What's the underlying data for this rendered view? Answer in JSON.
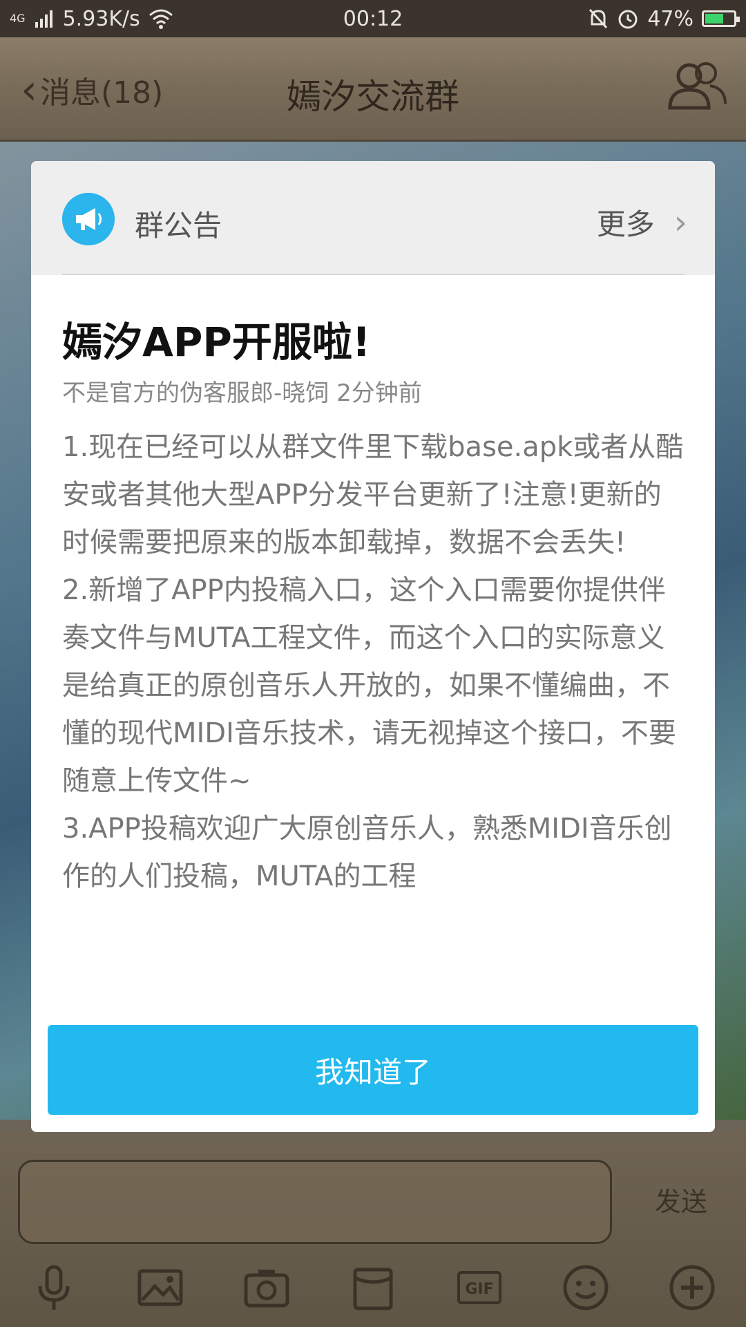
{
  "status_bar": {
    "network": "4G",
    "speed": "5.93K/s",
    "time": "00:12",
    "battery": "47%"
  },
  "header": {
    "back_label": "消息(18)",
    "title": "嫣汐交流群"
  },
  "modal": {
    "header_title": "群公告",
    "more_label": "更多",
    "title": "嫣汐APP开服啦!",
    "meta": "不是官方的伪客服郎-晓饲 2分钟前",
    "body": "1.现在已经可以从群文件里下载base.apk或者从酷安或者其他大型APP分发平台更新了!注意!更新的时候需要把原来的版本卸载掉，数据不会丢失!\n2.新增了APP内投稿入口，这个入口需要你提供伴奏文件与MUTA工程文件，而这个入口的实际意义是给真正的原创音乐人开放的，如果不懂编曲，不懂的现代MIDI音乐技术，请无视掉这个接口，不要随意上传文件~\n3.APP投稿欢迎广大原创音乐人，熟悉MIDI音乐创作的人们投稿，MUTA的工程",
    "ack_button": "我知道了"
  },
  "input": {
    "send_label": "发送"
  },
  "toolbar": {
    "icons": [
      "microphone-icon",
      "image-icon",
      "camera-icon",
      "envelope-icon",
      "gif-icon",
      "emoji-icon",
      "plus-icon"
    ],
    "gif_text": "GIF"
  },
  "colors": {
    "accent": "#22b9ee",
    "wood": "#7a6d5a"
  }
}
